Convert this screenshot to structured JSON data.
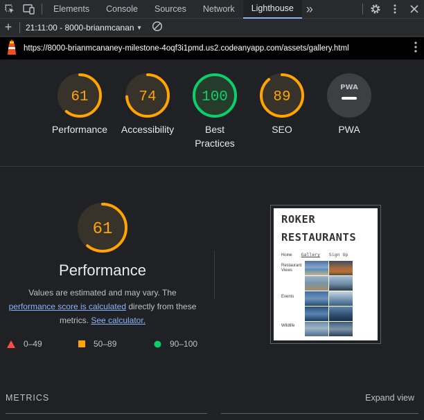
{
  "devtools": {
    "tabs": [
      {
        "label": "Elements"
      },
      {
        "label": "Console"
      },
      {
        "label": "Sources"
      },
      {
        "label": "Network"
      },
      {
        "label": "Lighthouse"
      }
    ],
    "more_tabs_glyph": "»"
  },
  "report_bar": {
    "plus": "+",
    "selected_report": "21:11:00 - 8000-brianmcanan"
  },
  "url_bar": {
    "url": "https://8000-brianmcananey-milestone-4oqf3i1pmd.us2.codeanyapp.com/assets/gallery.html"
  },
  "categories": [
    {
      "score": "61",
      "label": "Performance",
      "fraction": 0.61,
      "status": "average"
    },
    {
      "score": "74",
      "label": "Accessibility",
      "fraction": 0.74,
      "status": "average"
    },
    {
      "score": "100",
      "label": "Best Practices",
      "fraction": 1.0,
      "status": "pass"
    },
    {
      "score": "89",
      "label": "SEO",
      "fraction": 0.89,
      "status": "average"
    },
    {
      "score": "PWA",
      "label": "PWA",
      "status": "none"
    }
  ],
  "performance": {
    "score": "61",
    "fraction": 0.61,
    "title": "Performance",
    "desc_part1": "Values are estimated and may vary. The",
    "link1": "performance score is calculated",
    "desc_part2": "directly from these metrics.",
    "link2": "See calculator."
  },
  "legend": [
    {
      "range": "0–49",
      "shape": "triangle",
      "color": "#ff4e42"
    },
    {
      "range": "50–89",
      "shape": "square",
      "color": "#ffa400"
    },
    {
      "range": "90–100",
      "shape": "circle",
      "color": "#0cce6b"
    }
  ],
  "thumbnail": {
    "title_line1": "ROKER",
    "title_line2": "RESTAURANTS",
    "nav": [
      "Home",
      "Gallery",
      "Sign Up"
    ],
    "sections": [
      "Restaurant Views",
      "Events",
      "Wildlife"
    ]
  },
  "metrics": {
    "heading": "METRICS",
    "expand": "Expand view"
  },
  "colors": {
    "average": "#ffa400",
    "pass": "#0cce6b",
    "fail": "#ff4e42",
    "link": "#8ab4f8"
  }
}
